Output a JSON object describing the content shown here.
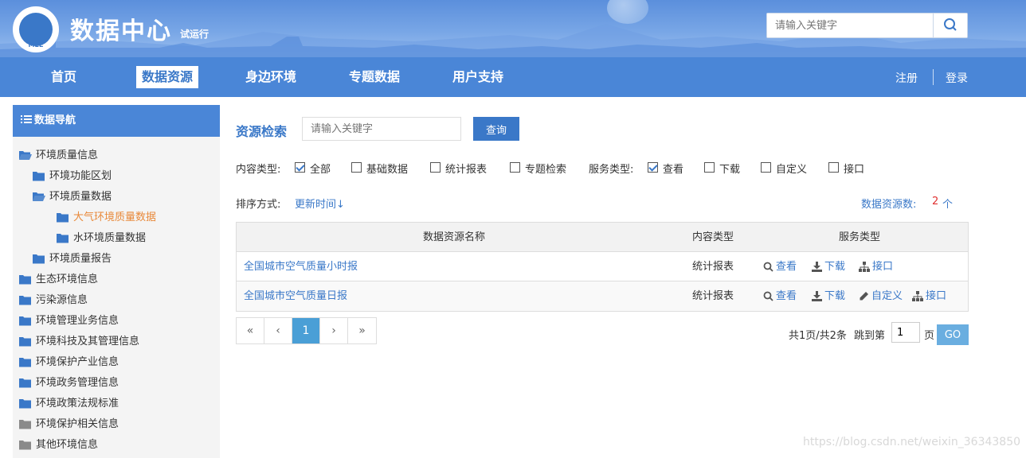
{
  "header": {
    "site_title": "数据中心",
    "site_subtitle": "试运行",
    "logo_text": "MEE",
    "search_placeholder": "请输入关键字"
  },
  "nav": {
    "items": [
      "首页",
      "数据资源",
      "身边环境",
      "专题数据",
      "用户支持"
    ],
    "active": "数据资源",
    "register": "注册",
    "login": "登录"
  },
  "sidebar": {
    "title": "数据导航",
    "tree": [
      {
        "label": "环境质量信息",
        "level": 0,
        "open": true
      },
      {
        "label": "环境功能区划",
        "level": 1
      },
      {
        "label": "环境质量数据",
        "level": 1,
        "open": true
      },
      {
        "label": "大气环境质量数据",
        "level": 2,
        "active": true
      },
      {
        "label": "水环境质量数据",
        "level": 2
      },
      {
        "label": "环境质量报告",
        "level": 1
      },
      {
        "label": "生态环境信息",
        "level": 0
      },
      {
        "label": "污染源信息",
        "level": 0
      },
      {
        "label": "环境管理业务信息",
        "level": 0
      },
      {
        "label": "环境科技及其管理信息",
        "level": 0
      },
      {
        "label": "环境保护产业信息",
        "level": 0
      },
      {
        "label": "环境政务管理信息",
        "level": 0
      },
      {
        "label": "环境政策法规标准",
        "level": 0
      },
      {
        "label": "环境保护相关信息",
        "level": 0,
        "grey": true
      },
      {
        "label": "其他环境信息",
        "level": 0,
        "grey": true
      }
    ]
  },
  "search": {
    "title": "资源检索",
    "placeholder": "请输入关键字",
    "button": "查询"
  },
  "filters": {
    "content_label": "内容类型:",
    "content_options": [
      {
        "label": "全部",
        "checked": true
      },
      {
        "label": "基础数据",
        "checked": false
      },
      {
        "label": "统计报表",
        "checked": false
      },
      {
        "label": "专题检索",
        "checked": false
      }
    ],
    "service_label": "服务类型:",
    "service_options": [
      {
        "label": "查看",
        "checked": true
      },
      {
        "label": "下载",
        "checked": false
      },
      {
        "label": "自定义",
        "checked": false
      },
      {
        "label": "接口",
        "checked": false
      }
    ]
  },
  "sort": {
    "label": "排序方式:",
    "value": "更新时间↓",
    "count_label": "数据资源数:",
    "count": "2",
    "count_unit": "个"
  },
  "table": {
    "headers": [
      "数据资源名称",
      "内容类型",
      "服务类型"
    ],
    "rows": [
      {
        "name": "全国城市空气质量小时报",
        "type": "统计报表",
        "services": [
          "查看",
          "下载",
          "接口"
        ]
      },
      {
        "name": "全国城市空气质量日报",
        "type": "统计报表",
        "services": [
          "查看",
          "下载",
          "自定义",
          "接口"
        ]
      }
    ]
  },
  "pagination": {
    "first": "«",
    "prev": "‹",
    "current": "1",
    "next": "›",
    "last": "»",
    "summary": "共1页/共2条",
    "jump_label": "跳到第",
    "jump_value": "1",
    "page_unit": "页",
    "go": "GO"
  },
  "watermark": "https://blog.csdn.net/weixin_36343850",
  "colors": {
    "primary": "#4a86d7",
    "link": "#3a78c8",
    "active_tree": "#e8893a",
    "count": "#e03030"
  }
}
